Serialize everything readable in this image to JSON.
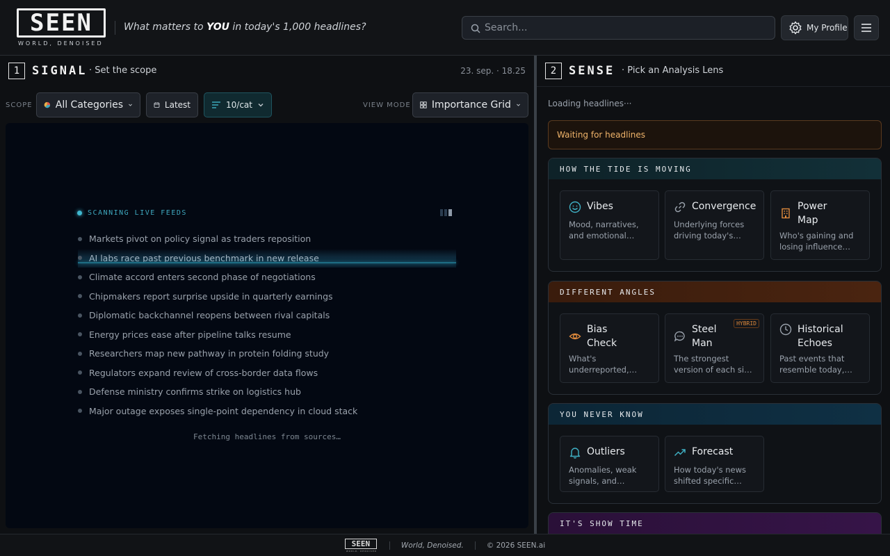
{
  "header": {
    "logo_text": "SEEN",
    "logo_tagline": "WORLD, DENOISED",
    "tagline_pre": "What matters to ",
    "tagline_em": "YOU",
    "tagline_post": " in today's 1,000 headlines?",
    "search_placeholder": "Search...",
    "profile_label": "My Profile"
  },
  "signal": {
    "number": "1",
    "title": "SIGNAL",
    "subtitle": "· Set the scope",
    "timestamp": "23. sep. · 18.25",
    "scope_label": "SCOPE",
    "category": "All Categories",
    "time_filter": "Latest",
    "per_cat": "10/cat",
    "view_mode_label": "VIEW MODE",
    "view_mode": "Importance Grid",
    "scan_title": "SCANNING LIVE FEEDS",
    "headlines": [
      "Markets pivot on policy signal as traders reposition",
      "AI labs race past previous benchmark in new release",
      "Climate accord enters second phase of negotiations",
      "Chipmakers report surprise upside in quarterly earnings",
      "Diplomatic backchannel reopens between rival capitals",
      "Energy prices ease after pipeline talks resume",
      "Researchers map new pathway in protein folding study",
      "Regulators expand review of cross-border data flows",
      "Defense ministry confirms strike on logistics hub",
      "Major outage exposes single-point dependency in cloud stack"
    ],
    "active_index": 1,
    "fetch_text": "Fetching headlines from sources…"
  },
  "sense": {
    "number": "2",
    "title": "SENSE",
    "subtitle": "· Pick an Analysis Lens",
    "loading": "Loading headlines···",
    "waiting": "Waiting for headlines",
    "groups": [
      {
        "title": "HOW THE TIDE IS MOVING",
        "cards": [
          {
            "title": "Vibes",
            "desc": "Mood, narratives, and emotional texture of the day's news",
            "icon": "smile-icon"
          },
          {
            "title": "Convergence",
            "desc": "Underlying forces driving today's headlines",
            "icon": "link-icon"
          },
          {
            "title": "Power\nMap",
            "desc": "Who's gaining and losing influence right now",
            "icon": "building-icon"
          }
        ]
      },
      {
        "title": "DIFFERENT ANGLES",
        "cards": [
          {
            "title": "Bias\nCheck",
            "desc": "What's underreported, overreported, and missing",
            "icon": "eye-icon"
          },
          {
            "title": "Steel\nMan",
            "desc": "The strongest version of each side on contested issues",
            "icon": "chat-icon",
            "badge": "HYBRID"
          },
          {
            "title": "Historical\nEchoes",
            "desc": "Past events that resemble today, with lessons",
            "icon": "clock-icon"
          }
        ]
      },
      {
        "title": "YOU NEVER KNOW",
        "cards": [
          {
            "title": "Outliers",
            "desc": "Anomalies, weak signals, and counter-trends",
            "icon": "bell-icon"
          },
          {
            "title": "Forecast",
            "desc": "How today's news shifted specific predictions",
            "icon": "trend-icon"
          }
        ]
      },
      {
        "title": "IT'S SHOW TIME",
        "cards": []
      }
    ]
  },
  "footer": {
    "motto": "World, Denoised.",
    "copyright": "© 2026 SEEN.ai"
  },
  "colors": {
    "accent_teal": "#3fa9c0",
    "warning_orange": "#f0b46a",
    "icon_teal": "#3fb0c4",
    "icon_orange": "#e08a3c"
  }
}
